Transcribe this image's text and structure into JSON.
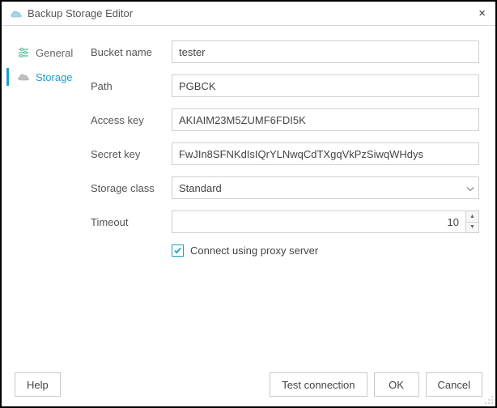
{
  "window": {
    "title": "Backup Storage Editor"
  },
  "sidebar": {
    "items": [
      {
        "label": "General"
      },
      {
        "label": "Storage"
      }
    ]
  },
  "form": {
    "bucket": {
      "label": "Bucket name",
      "value": "tester"
    },
    "path": {
      "label": "Path",
      "value": "PGBCK"
    },
    "access": {
      "label": "Access key",
      "value": "AKIAIM23M5ZUMF6FDI5K"
    },
    "secret": {
      "label": "Secret key",
      "value": "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"
    },
    "storage": {
      "label": "Storage class",
      "value": "Standard"
    },
    "timeout": {
      "label": "Timeout",
      "value": "10"
    },
    "proxy": {
      "label": "Connect using proxy server",
      "checked": true
    }
  },
  "buttons": {
    "help": "Help",
    "test": "Test connection",
    "ok": "OK",
    "cancel": "Cancel"
  }
}
